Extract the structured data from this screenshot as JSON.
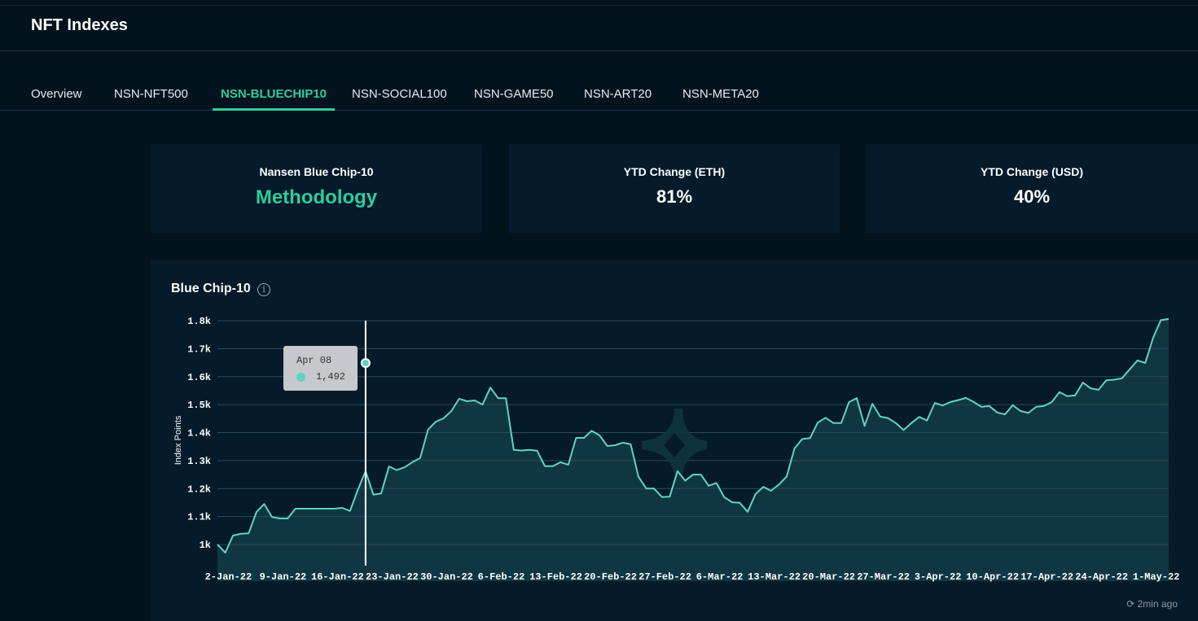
{
  "header": {
    "title": "NFT Indexes"
  },
  "tabs": [
    {
      "label": "Overview"
    },
    {
      "label": "NSN-NFT500"
    },
    {
      "label": "NSN-BLUECHIP10"
    },
    {
      "label": "NSN-SOCIAL100"
    },
    {
      "label": "NSN-GAME50"
    },
    {
      "label": "NSN-ART20"
    },
    {
      "label": "NSN-META20"
    }
  ],
  "active_tab": "NSN-BLUECHIP10",
  "cards": [
    {
      "label": "Nansen Blue Chip-10",
      "value": "Methodology"
    },
    {
      "label": "YTD Change (ETH)",
      "value": "81%"
    },
    {
      "label": "YTD Change (USD)",
      "value": "40%"
    }
  ],
  "chart_title": "Blue Chip-10",
  "updated": "2min ago",
  "tooltip": {
    "date": "Apr 08",
    "value": "1,492"
  },
  "colors": {
    "accent": "#2ecc9c",
    "line": "#5fd3c4",
    "fill": "#143c48",
    "bg": "#03131e",
    "card": "#051a2a"
  },
  "chart_data": {
    "type": "area",
    "title": "Blue Chip-10",
    "xlabel": "",
    "ylabel": "Index Points",
    "ylim": [
      870,
      1800
    ],
    "y_ticks": [
      {
        "v": 1000,
        "label": "1k"
      },
      {
        "v": 1100,
        "label": "1.1k"
      },
      {
        "v": 1200,
        "label": "1.2k"
      },
      {
        "v": 1300,
        "label": "1.3k"
      },
      {
        "v": 1400,
        "label": "1.4k"
      },
      {
        "v": 1500,
        "label": "1.5k"
      },
      {
        "v": 1600,
        "label": "1.6k"
      },
      {
        "v": 1700,
        "label": "1.7k"
      },
      {
        "v": 1800,
        "label": "1.8k"
      }
    ],
    "x_ticks": [
      "2-Jan-22",
      "9-Jan-22",
      "16-Jan-22",
      "23-Jan-22",
      "30-Jan-22",
      "6-Feb-22",
      "13-Feb-22",
      "20-Feb-22",
      "27-Feb-22",
      "6-Mar-22",
      "13-Mar-22",
      "20-Mar-22",
      "27-Mar-22",
      "3-Apr-22",
      "10-Apr-22",
      "17-Apr-22",
      "24-Apr-22",
      "1-May-22"
    ],
    "grid": true,
    "hover_index": 19,
    "values": [
      1000,
      971,
      1032,
      1038,
      1040,
      1116,
      1145,
      1098,
      1093,
      1093,
      1128,
      1128,
      1128,
      1128,
      1128,
      1128,
      1131,
      1120,
      1195,
      1262,
      1178,
      1182,
      1279,
      1266,
      1276,
      1294,
      1309,
      1410,
      1439,
      1451,
      1477,
      1521,
      1512,
      1515,
      1500,
      1561,
      1523,
      1523,
      1338,
      1336,
      1338,
      1335,
      1280,
      1280,
      1294,
      1285,
      1381,
      1381,
      1406,
      1390,
      1352,
      1355,
      1364,
      1358,
      1242,
      1200,
      1200,
      1170,
      1171,
      1262,
      1228,
      1250,
      1250,
      1210,
      1220,
      1169,
      1151,
      1149,
      1117,
      1180,
      1206,
      1192,
      1214,
      1243,
      1343,
      1377,
      1380,
      1436,
      1453,
      1434,
      1434,
      1509,
      1523,
      1424,
      1503,
      1457,
      1452,
      1434,
      1409,
      1434,
      1456,
      1443,
      1506,
      1497,
      1509,
      1516,
      1524,
      1509,
      1492,
      1495,
      1472,
      1465,
      1498,
      1477,
      1470,
      1492,
      1495,
      1509,
      1545,
      1530,
      1533,
      1579,
      1558,
      1553,
      1587,
      1589,
      1594,
      1626,
      1658,
      1649,
      1739,
      1802,
      1806
    ]
  }
}
